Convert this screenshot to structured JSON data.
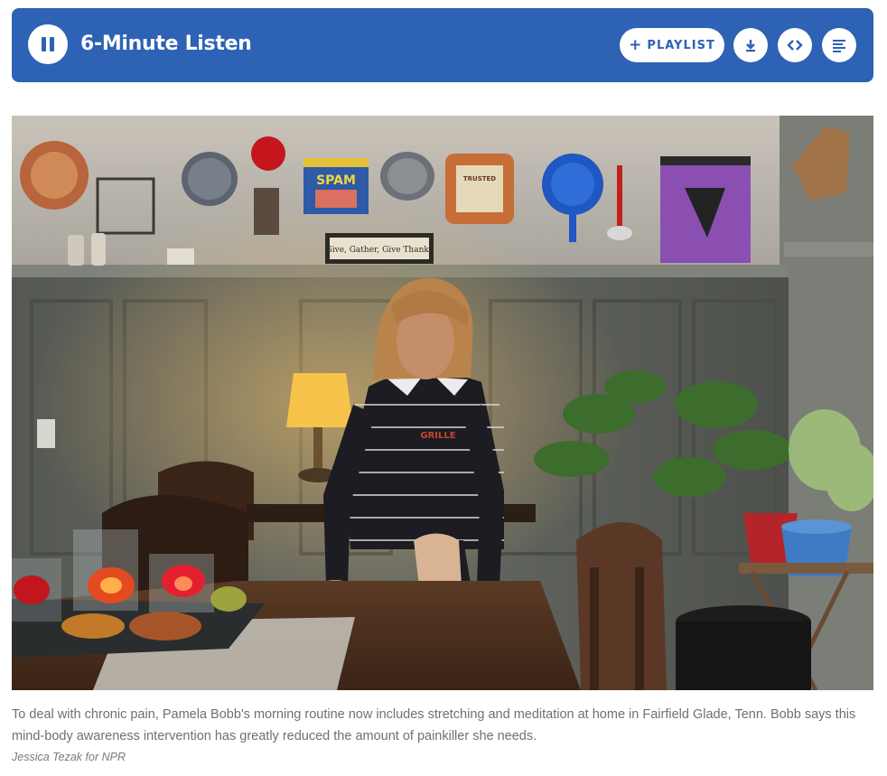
{
  "player": {
    "title": "6-Minute Listen",
    "playlist_label": "PLAYLIST",
    "playlist_icon": "plus-icon",
    "icons": [
      "pause-icon",
      "download-icon",
      "embed-icon",
      "transcript-icon"
    ],
    "accent_color": "#2d62b4"
  },
  "photo": {
    "sign_text": "Give, Gather, Give Thanks",
    "can_label": "SPAM",
    "shirt_logo": "GRILLE",
    "package_label": "TRUSTED"
  },
  "caption": {
    "text": "To deal with chronic pain, Pamela Bobb's morning routine now includes stretching and meditation at home in Fairfield Glade, Tenn. Bobb says this mind-body awareness intervention has greatly reduced the amount of painkiller she needs.",
    "credit": "Jessica Tezak for NPR"
  }
}
